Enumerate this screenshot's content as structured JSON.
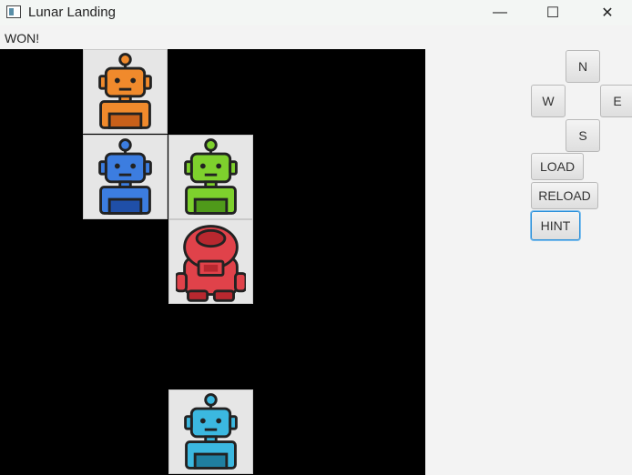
{
  "window": {
    "title": "Lunar Landing",
    "minimize_glyph": "—",
    "maximize_glyph": "☐",
    "close_glyph": "✕"
  },
  "status": {
    "text": "WON!"
  },
  "board": {
    "background": "#000000",
    "tiles": [
      {
        "name": "orange-robot",
        "color": "#f08a2c",
        "row": 0,
        "col": 1
      },
      {
        "name": "blue-robot",
        "color": "#3c7de0",
        "row": 1,
        "col": 1
      },
      {
        "name": "green-robot",
        "color": "#7ed12d",
        "row": 1,
        "col": 2
      },
      {
        "name": "red-astronaut",
        "color": "#e0424a",
        "row": 2,
        "col": 2
      },
      {
        "name": "cyan-robot",
        "color": "#3bb8e0",
        "row": 4,
        "col": 2
      }
    ]
  },
  "controls": {
    "north": "N",
    "west": "W",
    "east": "E",
    "south": "S",
    "load": "LOAD",
    "reload": "RELOAD",
    "hint": "HINT"
  }
}
